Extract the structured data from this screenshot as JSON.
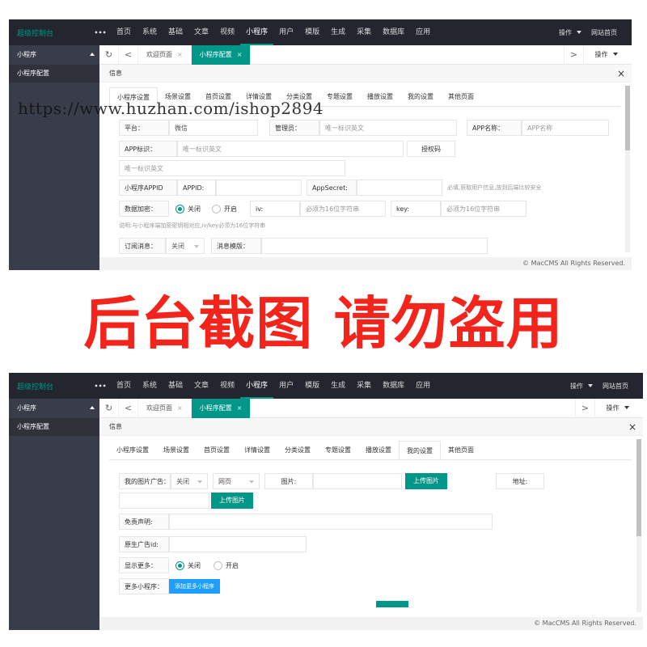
{
  "admin": {
    "brand": "超级控制台",
    "more": "•••",
    "nav": [
      "首页",
      "系统",
      "基础",
      "文章",
      "视频",
      "小程序",
      "用户",
      "模版",
      "生成",
      "采集",
      "数据库",
      "应用"
    ],
    "active_nav": "小程序",
    "top_ops": "操作",
    "site_home": "网站首页",
    "sidebar_head": "小程序",
    "sidebar_item": "小程序配置",
    "refresh_icon": "refresh-icon",
    "tab_welcome": "欢迎页面",
    "tab_config": "小程序配置",
    "tab_close": "×",
    "tab_ops": "操作",
    "info": "信息",
    "close": "×",
    "prev": "<",
    "next": ">",
    "footer": "© MacCMS All Rights Reserved.",
    "settings_tabs": [
      "小程序设置",
      "场景设置",
      "首页设置",
      "详情设置",
      "分类设置",
      "专题设置",
      "播放设置",
      "我的设置",
      "其他页面"
    ]
  },
  "top": {
    "active_tab": "小程序设置",
    "platform_label": "平台：",
    "platform_value": "微信",
    "admin_label": "管理员：",
    "admin_placeholder": "唯一标识英文",
    "appname_label": "APP名称：",
    "appname_placeholder": "APP名称",
    "appid_label": "APP标识：",
    "appid_placeholder": "唯一标识英文",
    "auth_button": "授权码",
    "auth_placeholder": "唯一标识英文",
    "mp_label": "小程序APPID",
    "appid2_label": "APPID:",
    "secret_label": "AppSecret:",
    "secret_hint": "必填,获取用户信息,放到后端比较安全",
    "encrypt_label": "数据加密：",
    "radio_off": "关闭",
    "radio_on": "开启",
    "iv_label": "iv:",
    "iv_placeholder": "必须为16位字符串",
    "key_label": "key:",
    "key_placeholder": "必须为16位字符串",
    "note": "说明:与小程序端加密密钥相对应,iv/key必须为16位字符串",
    "sub_label": "订阅消息：",
    "sub_value": "关闭",
    "tpl_label": "消息模版："
  },
  "watermark": "https://www.huzhan.com/ishop2894",
  "banner": "后台截图 请勿盗用",
  "bottom": {
    "active_tab": "我的设置",
    "ad_label": "我的图片广告：",
    "ad_state": "关闭",
    "ad_type": "网页",
    "image_label": "图片:",
    "upload_button": "上传图片",
    "addr_label": "地址:",
    "upload_button2": "上传图片",
    "disclaimer_label": "免责声明:",
    "native_label": "原生广告id:",
    "more_label": "显示更多：",
    "radio_off": "关闭",
    "radio_on": "开启",
    "more_mp_label": "更多小程序：",
    "add_button": "添加更多小程序"
  }
}
